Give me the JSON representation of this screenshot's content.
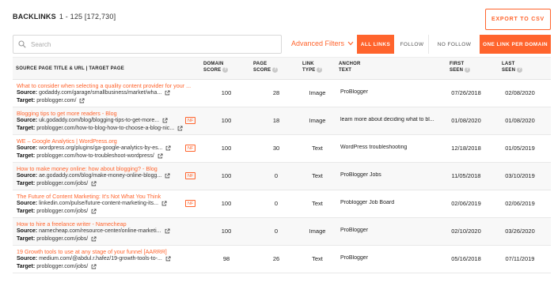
{
  "header": {
    "title": "BACKLINKS",
    "range": "1 - 125 [172,730]",
    "export_label": "EXPORT TO CSV"
  },
  "filters": {
    "search_placeholder": "Search",
    "advanced_label": "Advanced Filters",
    "all_links": "ALL LINKS",
    "follow": "FOLLOW",
    "no_follow": "NO FOLLOW",
    "one_per_domain": "ONE LINK PER DOMAIN",
    "active": "all_links"
  },
  "columns": {
    "source": "SOURCE PAGE TITLE & URL | TARGET PAGE",
    "domain_score_1": "DOMAIN",
    "domain_score_2": "SCORE",
    "page_score_1": "PAGE",
    "page_score_2": "SCORE",
    "link_type_1": "LINK",
    "link_type_2": "TYPE",
    "anchor_1": "ANCHOR",
    "anchor_2": "TEXT",
    "first_seen_1": "FIRST",
    "first_seen_2": "SEEN",
    "last_seen_1": "LAST",
    "last_seen_2": "SEEN"
  },
  "labels": {
    "source": "Source:",
    "target": "Target:",
    "nf": "NF"
  },
  "rows": [
    {
      "title": "What to consider when selecting a quality content provider for your ...",
      "source": "godaddy.com/garage/smallbusiness/market/wha...",
      "target": "problogger.com/",
      "nf": false,
      "domain_score": "100",
      "page_score": "28",
      "link_type": "Image",
      "anchor": "ProBlogger",
      "first_seen": "07/26/2018",
      "last_seen": "02/08/2020"
    },
    {
      "title": "Blogging tips to get more readers - Blog",
      "source": "uk.godaddy.com/blog/blogging-tips-to-get-more...",
      "target": "problogger.com/how-to-blog-how-to-choose-a-blog-nic...",
      "nf": true,
      "domain_score": "100",
      "page_score": "18",
      "link_type": "Image",
      "anchor": "learn more about deciding what to bl...",
      "first_seen": "01/08/2020",
      "last_seen": "01/08/2020"
    },
    {
      "title": "WE – Google Analytics | WordPress.org",
      "source": "wordpress.org/plugins/ga-google-analytics-by-es...",
      "target": "problogger.com/how-to-troubleshoot-wordpress/",
      "nf": true,
      "domain_score": "100",
      "page_score": "30",
      "link_type": "Text",
      "anchor": "WordPress troubleshooting",
      "first_seen": "12/18/2018",
      "last_seen": "01/05/2019"
    },
    {
      "title": "How to make money online: how about blogging? - Blog",
      "source": "ae.godaddy.com/blog/make-money-online-blogg...",
      "target": "problogger.com/jobs/",
      "nf": true,
      "domain_score": "100",
      "page_score": "0",
      "link_type": "Text",
      "anchor": "ProBlogger Jobs",
      "first_seen": "11/05/2018",
      "last_seen": "03/10/2019"
    },
    {
      "title": "The Future of Content Marketing: It's Not What You Think",
      "source": "linkedin.com/pulse/future-content-marketing-its...",
      "target": "problogger.com/jobs/",
      "nf": true,
      "domain_score": "100",
      "page_score": "0",
      "link_type": "Text",
      "anchor": "Problogger Job Board",
      "first_seen": "02/06/2019",
      "last_seen": "02/06/2019"
    },
    {
      "title": "How to hire a freelance writer - Namecheap",
      "source": "namecheap.com/resource-center/online-marketi...",
      "target": "problogger.com/jobs/",
      "nf": false,
      "domain_score": "100",
      "page_score": "0",
      "link_type": "Image",
      "anchor": "ProBlogger",
      "first_seen": "02/10/2020",
      "last_seen": "03/26/2020"
    },
    {
      "title": "19 Growth tools to use at any stage of your funnel [AARRR]",
      "source": "medium.com/@abdul.r.hafez/19-growth-tools-to-...",
      "target": "problogger.com/jobs/",
      "nf": false,
      "domain_score": "98",
      "page_score": "26",
      "link_type": "Text",
      "anchor": "ProBlogger",
      "first_seen": "05/16/2018",
      "last_seen": "07/11/2019"
    }
  ]
}
